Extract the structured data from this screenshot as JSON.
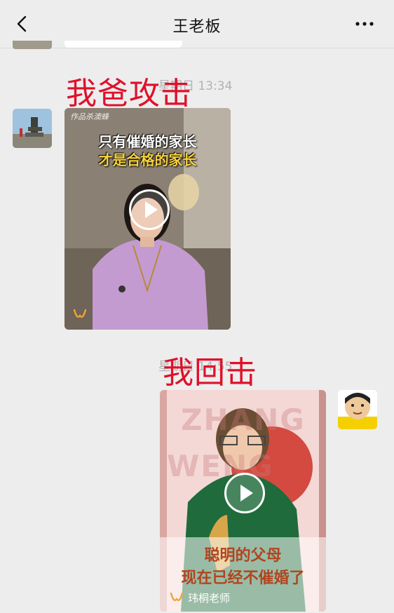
{
  "header": {
    "title": "王老板"
  },
  "chat": {
    "ts1": "星期日 13:34",
    "ts2": "星期日 14:55",
    "annotation1": "我爸攻击",
    "annotation2": "我回击",
    "video1": {
      "watermark": "作品杀澳蜂",
      "line1": "只有催婚的家长",
      "line2": "才是合格的家长"
    },
    "video2": {
      "bg_text1": "ZHANG",
      "bg_text2": "WENG",
      "line1": "聪明的父母",
      "line2": "现在已经不催婚了",
      "source": "玮桐老师"
    }
  },
  "colors": {
    "annotation": "#e0102a",
    "bg": "#ededed"
  }
}
